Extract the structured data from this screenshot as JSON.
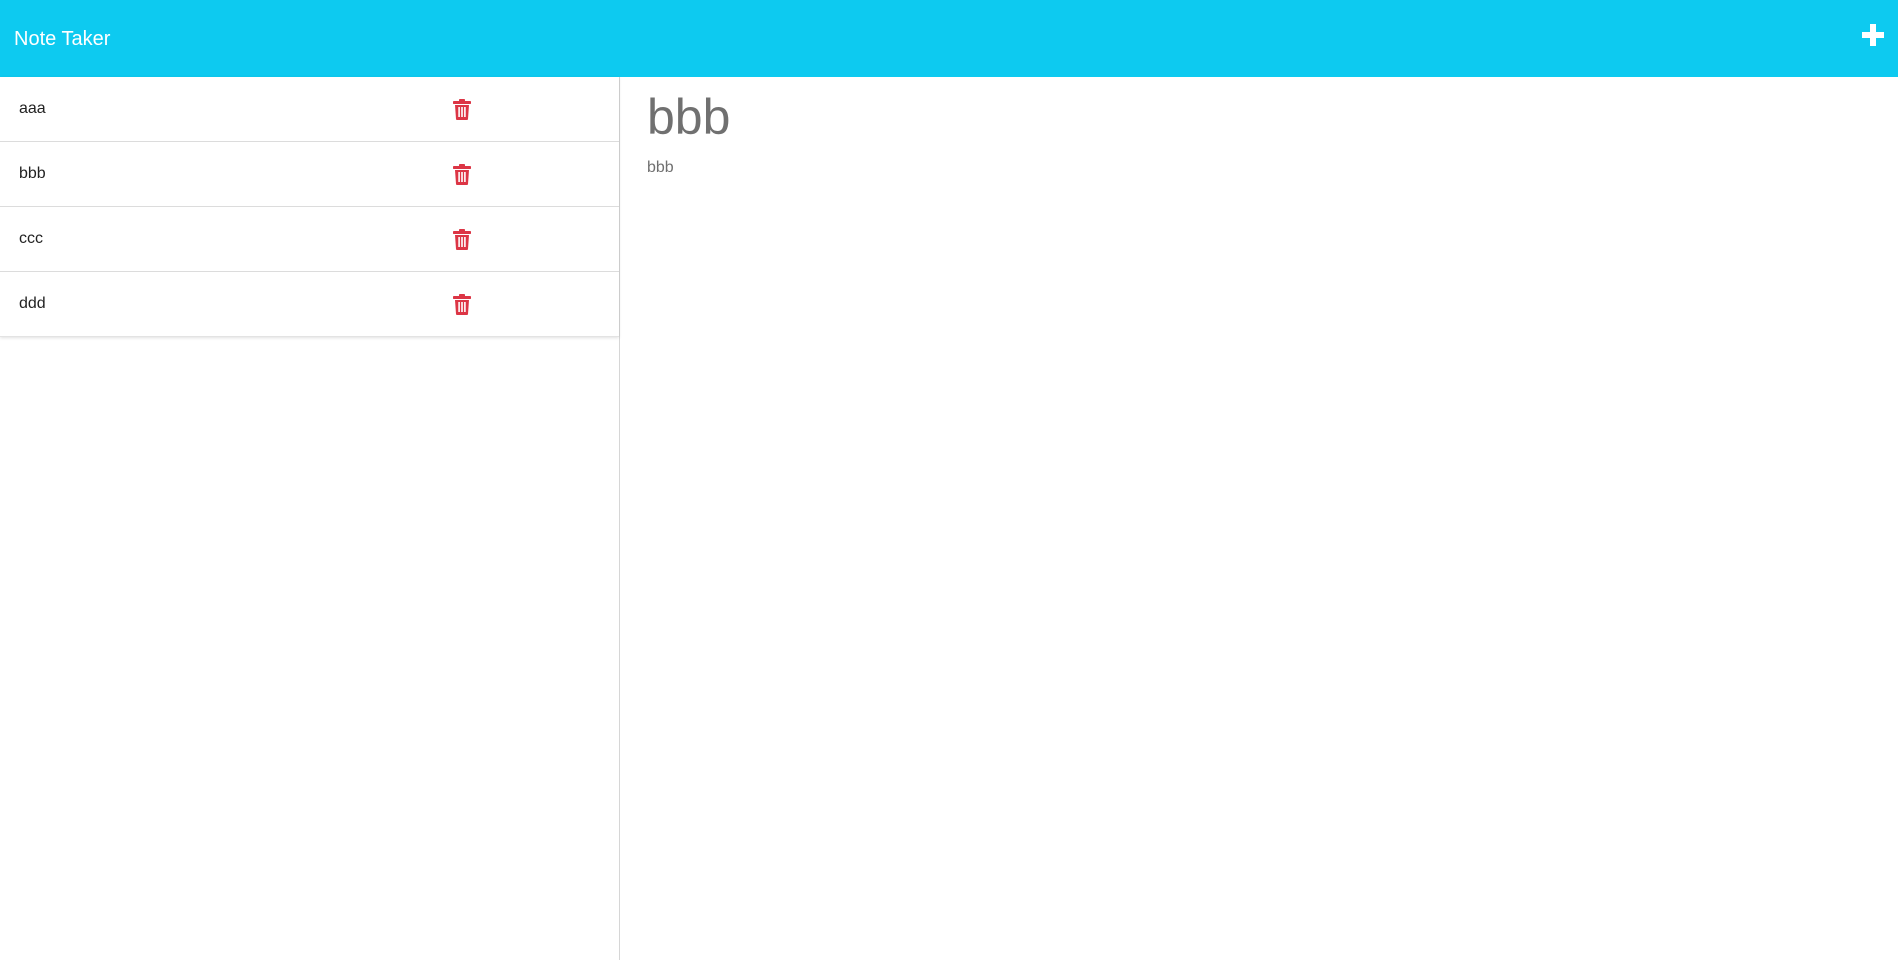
{
  "header": {
    "brand": "Note Taker",
    "new_note_icon": "plus-icon",
    "background_color": "#0dcaf0"
  },
  "notes": [
    {
      "title": "aaa",
      "delete_icon": "trash-icon"
    },
    {
      "title": "bbb",
      "delete_icon": "trash-icon"
    },
    {
      "title": "ccc",
      "delete_icon": "trash-icon"
    },
    {
      "title": "ddd",
      "delete_icon": "trash-icon"
    }
  ],
  "active_note": {
    "title": "bbb",
    "text": "bbb"
  },
  "colors": {
    "delete_icon": "#dc3545",
    "note_text": "#707070"
  }
}
